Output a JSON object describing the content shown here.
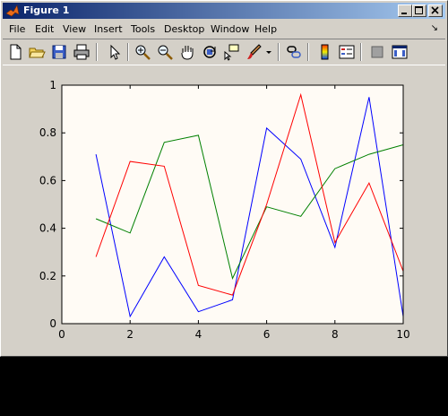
{
  "window": {
    "title": "Figure 1"
  },
  "menu": {
    "items": [
      {
        "label": "File"
      },
      {
        "label": "Edit"
      },
      {
        "label": "View"
      },
      {
        "label": "Insert"
      },
      {
        "label": "Tools"
      },
      {
        "label": "Desktop"
      },
      {
        "label": "Window"
      },
      {
        "label": "Help"
      }
    ]
  },
  "toolbar": {
    "tools": [
      {
        "name": "new-figure-icon"
      },
      {
        "name": "open-file-icon"
      },
      {
        "name": "save-figure-icon"
      },
      {
        "name": "print-figure-icon"
      },
      {
        "name": "edit-plot-arrow-icon"
      },
      {
        "name": "zoom-in-icon"
      },
      {
        "name": "zoom-out-icon"
      },
      {
        "name": "pan-hand-icon"
      },
      {
        "name": "rotate-3d-icon"
      },
      {
        "name": "data-cursor-icon"
      },
      {
        "name": "brush-icon"
      },
      {
        "name": "link-plot-icon"
      },
      {
        "name": "insert-colorbar-icon"
      },
      {
        "name": "insert-legend-icon"
      },
      {
        "name": "hide-plot-tools-icon"
      },
      {
        "name": "show-plot-tools-icon"
      }
    ]
  },
  "colors": {
    "plot_background": "#fffbf5",
    "series_colors": [
      "#0000ff",
      "#008000",
      "#ff0000"
    ]
  },
  "chart_data": {
    "type": "line",
    "title": "",
    "xlabel": "",
    "ylabel": "",
    "xlim": [
      0,
      10
    ],
    "ylim": [
      0,
      1
    ],
    "xticks": [
      0,
      2,
      4,
      6,
      8,
      10
    ],
    "yticks": [
      0,
      0.2,
      0.4,
      0.6,
      0.8,
      1
    ],
    "xtick_labels": [
      "0",
      "2",
      "4",
      "6",
      "8",
      "10"
    ],
    "ytick_labels": [
      "0",
      "0.2",
      "0.4",
      "0.6",
      "0.8",
      "1"
    ],
    "grid": false,
    "x": [
      1,
      2,
      3,
      4,
      5,
      6,
      7,
      8,
      9,
      10
    ],
    "series": [
      {
        "color": "#0000ff",
        "values": [
          0.71,
          0.03,
          0.28,
          0.05,
          0.1,
          0.82,
          0.69,
          0.32,
          0.95,
          0.03
        ]
      },
      {
        "color": "#008000",
        "values": [
          0.44,
          0.38,
          0.76,
          0.79,
          0.19,
          0.49,
          0.45,
          0.65,
          0.71,
          0.75
        ]
      },
      {
        "color": "#ff0000",
        "values": [
          0.28,
          0.68,
          0.66,
          0.16,
          0.12,
          0.5,
          0.96,
          0.34,
          0.59,
          0.22
        ]
      }
    ]
  }
}
